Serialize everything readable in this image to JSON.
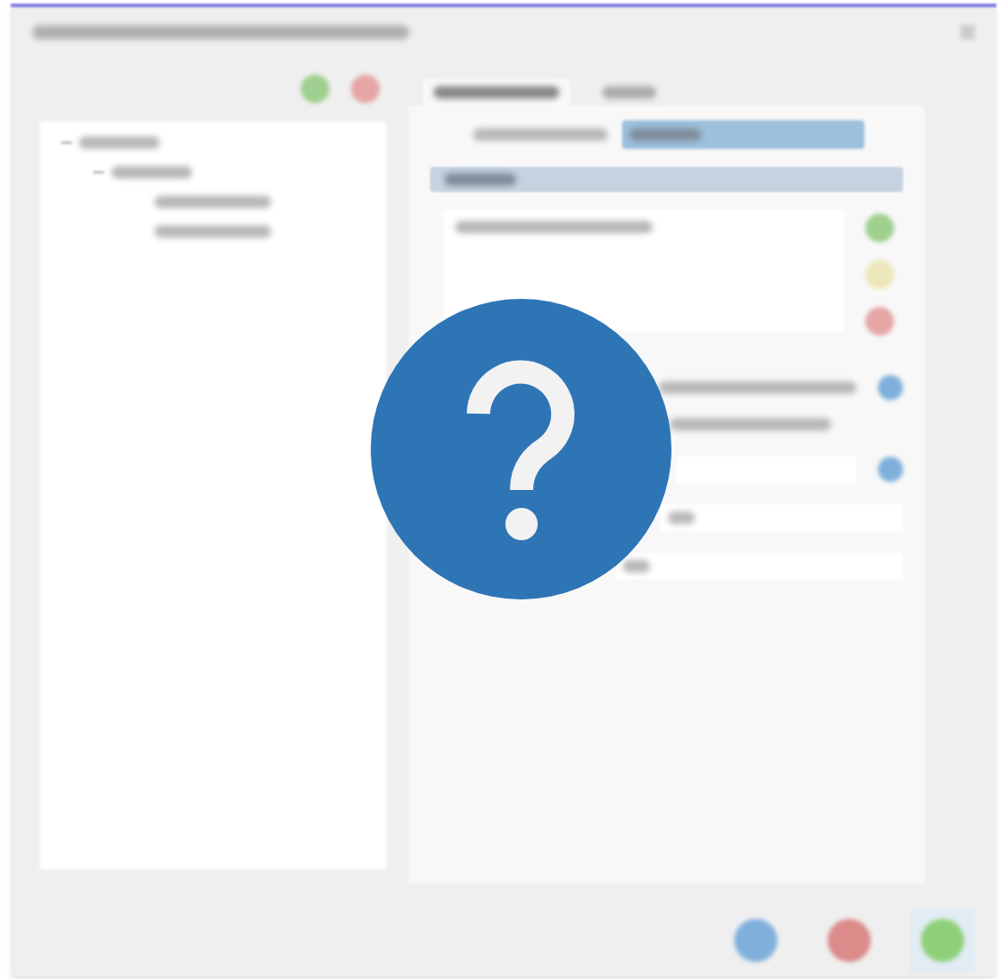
{
  "tree": {
    "nodes": [
      {
        "expanded": true,
        "children": [
          {
            "expanded": true,
            "children": [
              {
                "kind": "leaf"
              },
              {
                "kind": "leaf"
              }
            ]
          }
        ]
      }
    ]
  },
  "tree_actions": [
    {
      "kind": "add"
    },
    {
      "kind": "delete"
    }
  ],
  "tabs": [
    {
      "selected": true
    },
    {
      "selected": false
    }
  ],
  "list_actions": [
    {
      "kind": "add"
    },
    {
      "kind": "edit"
    },
    {
      "kind": "delete"
    }
  ],
  "buttons": [
    {
      "kind": "help",
      "selected": false
    },
    {
      "kind": "cancel",
      "selected": false
    },
    {
      "kind": "ok",
      "selected": true
    }
  ],
  "overlay": {
    "kind": "question"
  }
}
